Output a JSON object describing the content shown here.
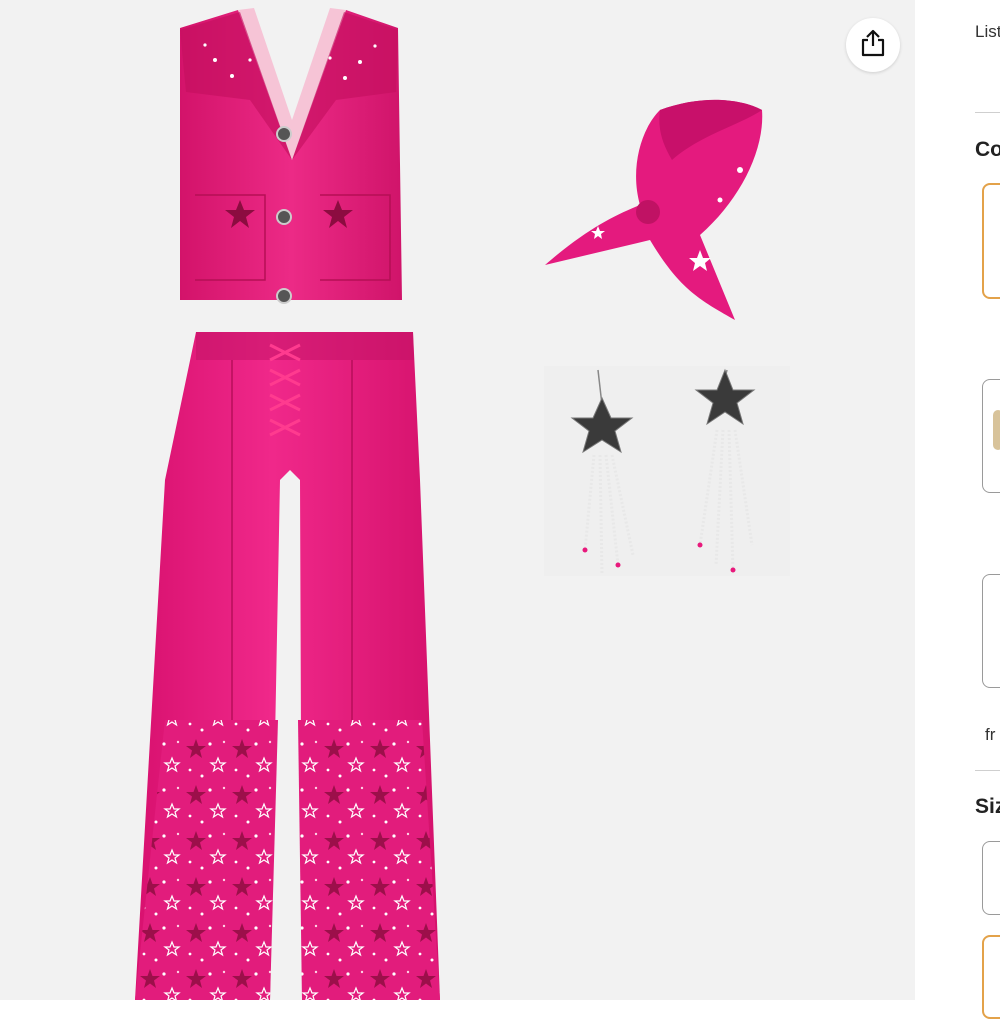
{
  "product": {
    "share_icon": "share-icon",
    "items": [
      "vest",
      "bandana",
      "earrings",
      "flared-pants"
    ]
  },
  "right_panel": {
    "top_text": "List",
    "color_heading": "Co",
    "from_text": "fr",
    "size_heading": "Siz"
  },
  "colors": {
    "pink": "#e8197c",
    "dark_pink": "#b40d55",
    "selected_border": "#e3a24a"
  }
}
